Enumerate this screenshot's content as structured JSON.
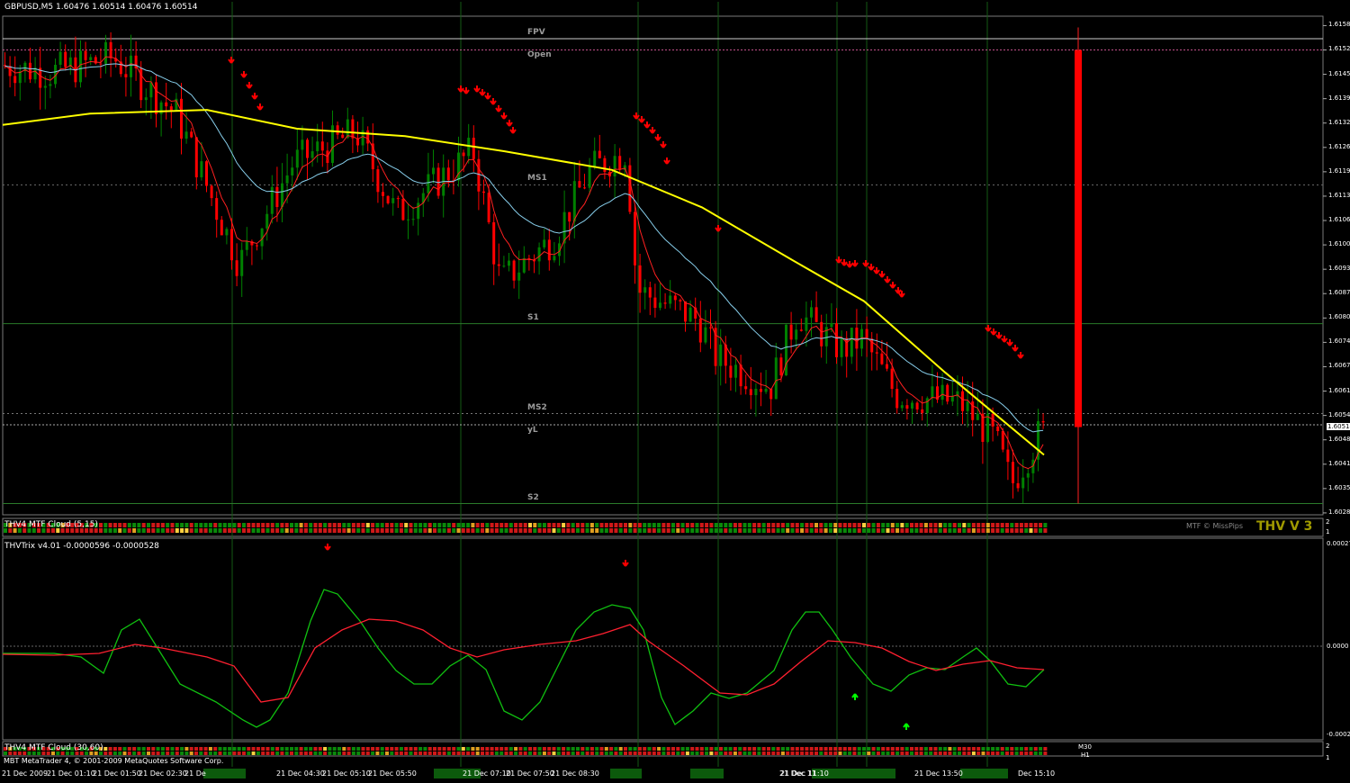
{
  "chart_data": {
    "type": "candlestick",
    "title": "GBPUSD,M5 1.60476 1.60514 1.60476 1.60514",
    "symbol": "GBPUSD",
    "timeframe": "M5",
    "ohlc_header": "1.60476 1.60514 1.60476 1.60514",
    "last_price": "1.60514",
    "price_axis": [
      "1.61585",
      "1.61520",
      "1.61455",
      "1.61390",
      "1.61325",
      "1.61260",
      "1.61195",
      "1.61130",
      "1.61065",
      "1.61000",
      "1.60935",
      "1.60870",
      "1.60805",
      "1.60740",
      "1.60675",
      "1.60610",
      "1.60545",
      "1.60480",
      "1.60415",
      "1.60350",
      "1.60285"
    ],
    "ylim": [
      1.6028,
      1.6161
    ],
    "time_axis": [
      "21 Dec 2009",
      "21 Dec 01:10",
      "21 Dec 01:50",
      "21 Dec 02:30",
      "21 De",
      "21 Dec 04:30",
      "21 Dec 05:10",
      "21 Dec 05:50",
      "21 Dec 07:10",
      "21 Dec 07:50",
      "21 Dec 08:30",
      "21 Dec 11:10",
      "21 Dec 11",
      "21 Dec 13:50",
      "Dec 15:10"
    ],
    "pivot_levels": [
      {
        "label": "FPV",
        "price": 1.6155
      },
      {
        "label": "Open",
        "price": 1.6152
      },
      {
        "label": "MS1",
        "price": 1.6116
      },
      {
        "label": "S1",
        "price": 1.6079
      },
      {
        "label": "MS2",
        "price": 1.6055
      },
      {
        "label": "yL",
        "price": 1.6052
      },
      {
        "label": "S2",
        "price": 1.6031
      }
    ],
    "colors": {
      "bull": "#008000",
      "bear": "#ff0000",
      "ma_fast": "#ff2020",
      "ma_mid": "#87ceeb",
      "ma_slow": "#ffff00",
      "grid": "#145a14",
      "up_arrow": "#00ff00",
      "down_arrow": "#ff0000"
    }
  },
  "panels": {
    "cloud1": {
      "label": "THV4 MTF Cloud (5,15)",
      "credit": "MTF © MissPips",
      "brand": "THV V 3",
      "scale": [
        "2",
        "1"
      ]
    },
    "trix": {
      "label": "THVTrix v4.01 -0.0000596 -0.0000528",
      "axis": [
        "0.00027",
        "0.0000",
        "-0.00023"
      ],
      "ylim": [
        -0.00023,
        0.00027
      ]
    },
    "cloud2": {
      "label": "THV4 MTF Cloud (30,60)",
      "tf_labels": [
        "M30",
        "H1"
      ],
      "scale": [
        "2",
        "1"
      ]
    }
  },
  "footer": {
    "copyright": "MBT MetaTrader 4, © 2001-2009 MetaQuotes Software Corp."
  }
}
